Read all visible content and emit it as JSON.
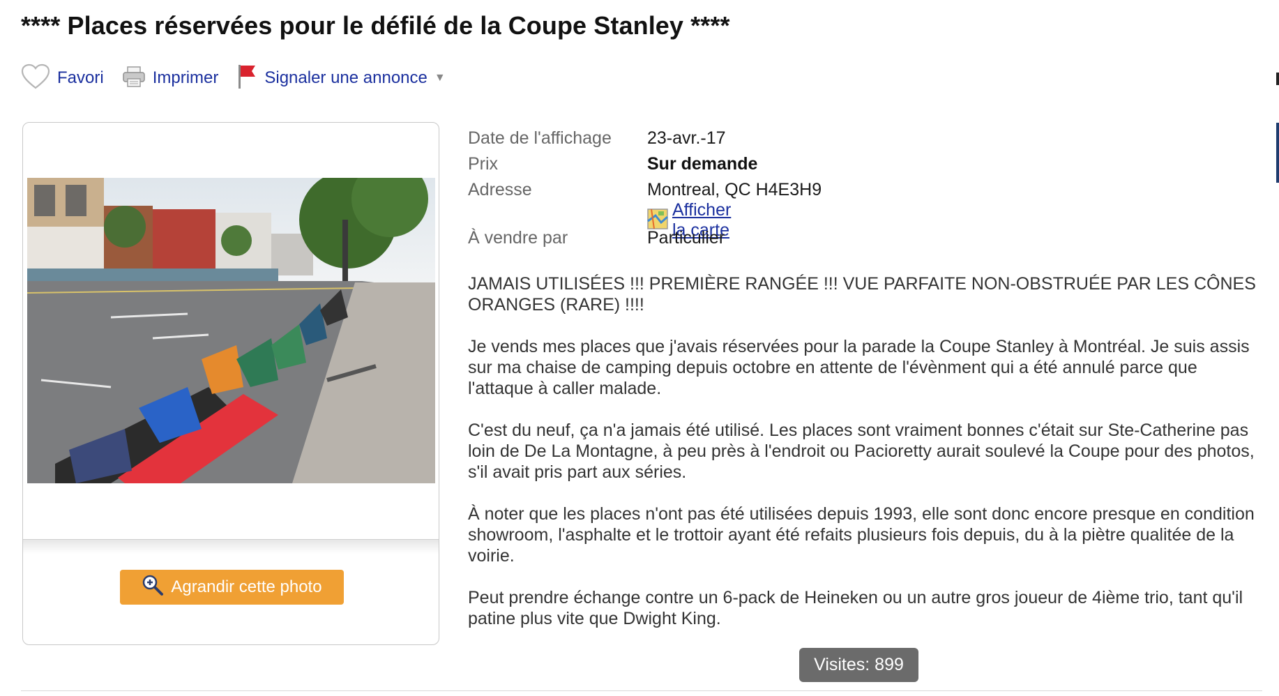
{
  "listing": {
    "title": "**** Places réservées pour le défilé de la Coupe Stanley ****"
  },
  "actions": {
    "favorite_label": "Favori",
    "print_label": "Imprimer",
    "report_label": "Signaler une annonce",
    "report_caret": "▼"
  },
  "photo": {
    "enlarge_label": "Agrandir cette photo"
  },
  "details": {
    "posted_label": "Date de l'affichage",
    "posted_value": "23-avr.-17",
    "price_label": "Prix",
    "price_value": "Sur demande",
    "address_label": "Adresse",
    "address_value": "Montreal, QC H4E3H9",
    "map_link": "Afficher la carte",
    "seller_label": "À vendre par",
    "seller_value": "Particulier"
  },
  "description": {
    "paragraphs": [
      "JAMAIS UTILISÉES !!! PREMIÈRE RANGÉE !!! VUE PARFAITE NON-OBSTRUÉE PAR LES CÔNES ORANGES (RARE) !!!!",
      "Je vends mes places que j'avais réservées pour la parade la Coupe Stanley à Montréal. Je suis assis sur ma chaise de camping depuis octobre en attente de l'évènment qui a été annulé parce que l'attaque à caller malade.",
      "C'est du neuf, ça n'a jamais été utilisé. Les places sont vraiment bonnes c'était sur Ste-Catherine pas loin de De La Montagne, à peu près à l'endroit ou Pacioretty aurait soulevé la Coupe pour des photos, s'il avait pris part aux séries.",
      "À noter que les places n'ont pas été utilisées depuis 1993, elle sont donc encore presque en condition showroom, l'asphalte et le trottoir ayant été refaits plusieurs fois depuis, du à la piètre qualitée de la voirie.",
      "Peut prendre échange contre un 6-pack de Heineken ou un autre gros joueur de 4ième trio, tant qu'il patine plus vite que Dwight King."
    ]
  },
  "stats": {
    "visits": "Visites: 899"
  },
  "colors": {
    "link": "#1a2f9e",
    "button_orange": "#f0a034",
    "visits_badge": "#6b6b6b",
    "report_flag": "#d9232e"
  }
}
